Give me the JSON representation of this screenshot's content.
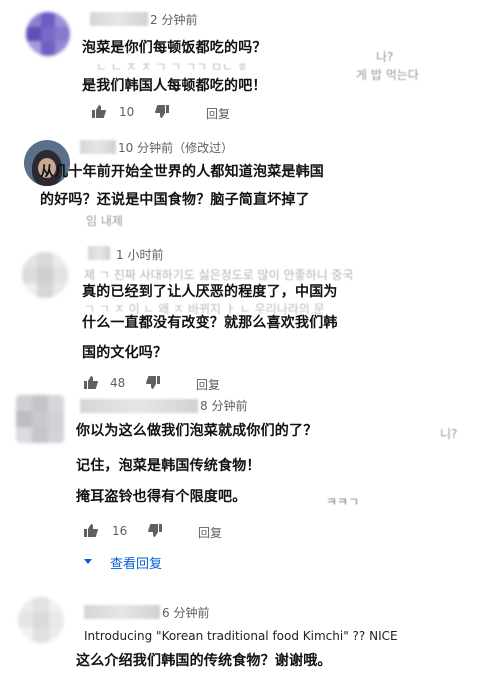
{
  "comments": [
    {
      "time": "2 分钟前",
      "lines": [
        "泡菜是你们每顿饭都吃的吗？",
        "是我们韩国人每顿都吃的吧！"
      ],
      "ghost_tail": [
        "나?",
        "게 밥 먹는다"
      ],
      "likes": "10",
      "reply_label": "回复"
    },
    {
      "time": "10 分钟前（修改过）",
      "lines": [
        "从几十年前开始全世界的人都知道泡菜是韩国",
        "的好吗？还说是中国食物？脑子简直坏掉了"
      ],
      "ghost_tail": [
        "임 내제"
      ],
      "likes": "",
      "reply_label": ""
    },
    {
      "time": "1 小时前",
      "lines": [
        "真的已经到了让人厌恶的程度了，中国为",
        "什么一直都没有改变？就那么喜欢我们韩",
        "国的文化吗？"
      ],
      "likes": "48",
      "reply_label": "回复"
    },
    {
      "time": "8 分钟前",
      "lines": [
        "你以为这么做我们泡菜就成你们的了？",
        "记住，泡菜是韩国传统食物！",
        "掩耳盗铃也得有个限度吧。"
      ],
      "ghost_tail": [
        "니?",
        "ㅋㅋㄱ"
      ],
      "likes": "16",
      "reply_label": "回复",
      "view_replies": "查看回复"
    },
    {
      "time": "6 分钟前",
      "english": "Introducing \"Korean traditional food Kimchi\" ?? NICE",
      "lines": [
        "这么介绍我们韩国的传统食物？谢谢哦。"
      ]
    }
  ],
  "colors": {
    "meta": "#606060",
    "link": "#065fd4",
    "avatar_purple": "#7b68c8"
  }
}
